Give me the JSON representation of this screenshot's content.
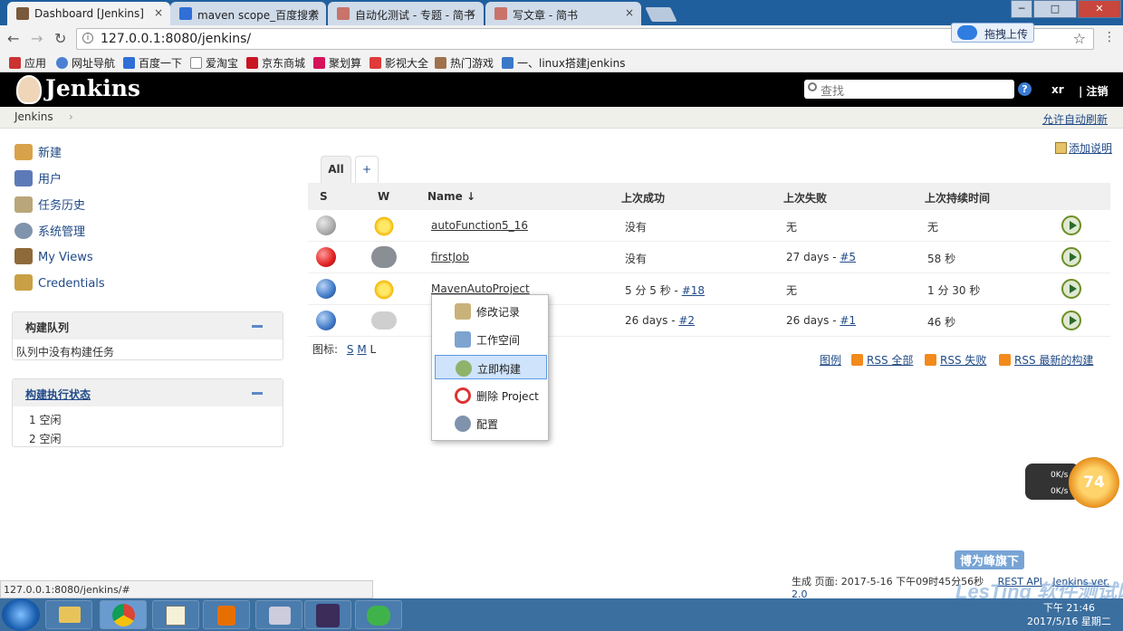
{
  "browser": {
    "tabs": [
      {
        "title": "Dashboard [Jenkins]",
        "fav_color": "#7a5a3c",
        "close": "×"
      },
      {
        "title": "maven scope_百度搜索",
        "fav_color": "#2f6fd6",
        "close": "×"
      },
      {
        "title": "自动化测试 - 专题 - 简书",
        "fav_color": "#c9736a",
        "close": "×"
      },
      {
        "title": "写文章 - 简书",
        "fav_color": "#c9736a",
        "close": "×"
      }
    ],
    "window_controls": [
      "─",
      "□",
      "✕"
    ],
    "url": "127.0.0.1:8080/jenkins/",
    "upload_button": "拖拽上传",
    "bookmarks": [
      {
        "label": "应用",
        "color": "#cc3333"
      },
      {
        "label": "网址导航",
        "color": "#4a7fd4"
      },
      {
        "label": "百度一下",
        "color": "#2f6fd6"
      },
      {
        "label": "爱淘宝",
        "color": "#dddddd"
      },
      {
        "label": "京东商城",
        "color": "#c91623"
      },
      {
        "label": "聚划算",
        "color": "#d4145a"
      },
      {
        "label": "影视大全",
        "color": "#e03a3a"
      },
      {
        "label": "热门游戏",
        "color": "#a0724c"
      },
      {
        "label": "一、linux搭建jenkins",
        "color": "#3c78c8"
      }
    ]
  },
  "jenkins": {
    "logo_text": "Jenkins",
    "search_placeholder": "查找",
    "help": "?",
    "user": "xr",
    "logout": "| 注销",
    "breadcrumb": "Jenkins",
    "breadcrumb_arrow": "›",
    "auto_refresh": "允许自动刷新",
    "add_description": "添加说明",
    "sidebar": [
      {
        "label": "新建",
        "color": "#d8a24a"
      },
      {
        "label": "用户",
        "color": "#5d7ab8"
      },
      {
        "label": "任务历史",
        "color": "#b9a77a"
      },
      {
        "label": "系统管理",
        "color": "#7f93ad"
      },
      {
        "label": "My Views",
        "color": "#8e6a3a"
      },
      {
        "label": "Credentials",
        "color": "#c9a043"
      }
    ],
    "queue": {
      "title": "构建队列",
      "empty": "队列中没有构建任务"
    },
    "executors": {
      "title": "构建执行状态",
      "items": [
        "1  空闲",
        "2  空闲"
      ]
    },
    "view_tabs": {
      "all": "All",
      "add": "+"
    },
    "table": {
      "headers": {
        "s": "S",
        "w": "W",
        "name": "Name  ↓",
        "last_success": "上次成功",
        "last_failure": "上次失败",
        "last_duration": "上次持续时间"
      },
      "rows": [
        {
          "name": "autoFunction5_16",
          "status_color": "#a9a9a9",
          "weather": "sun",
          "last_success": "没有",
          "last_success_link": "",
          "last_failure": "无",
          "last_failure_link": "",
          "duration": "无"
        },
        {
          "name": "firstJob",
          "status_color": "#e02020",
          "weather": "storm",
          "last_success": "没有",
          "last_success_link": "",
          "last_failure": "27 days - ",
          "last_failure_link": "#5",
          "duration": "58 秒"
        },
        {
          "name": "MavenAutoProject",
          "status_color": "#3f79c7",
          "weather": "sun",
          "last_success": "5 分 5 秒 - ",
          "last_success_link": "#18",
          "last_failure": "无",
          "last_failure_link": "",
          "duration": "1 分 30 秒"
        },
        {
          "name": "",
          "status_color": "#3f79c7",
          "weather": "cloud",
          "last_success": "26 days - ",
          "last_success_link": "#2",
          "last_failure": "26 days - ",
          "last_failure_link": "#1",
          "duration": "46 秒"
        }
      ]
    },
    "icon_size": {
      "label": "图标:",
      "s": "S",
      "m": "M",
      "l": "L"
    },
    "legend": "图例",
    "rss_all": "RSS 全部",
    "rss_failed": "RSS 失败",
    "rss_latest": "RSS 最新的构建",
    "context_menu": [
      {
        "label": "修改记录",
        "color": "#c9b27a"
      },
      {
        "label": "工作空间",
        "color": "#7ea3cf"
      },
      {
        "label": "立即构建",
        "color": "#8fb36a"
      },
      {
        "label": "删除 Project",
        "color": "#d33"
      },
      {
        "label": "配置",
        "color": "#7f93ad"
      }
    ],
    "footer": {
      "generated": "生成 页面: 2017-5-16 下午09时45分56秒",
      "rest": "REST API",
      "version": "Jenkins ver. 2.0"
    }
  },
  "status_url": "127.0.0.1:8080/jenkins/#",
  "net_meter": {
    "up": "0K/s",
    "down": "0K/s",
    "badge": "74"
  },
  "watermark": {
    "line1": "博为峰旗下",
    "line2": "LesTing 软件测试网"
  },
  "taskbar": {
    "time": "下午 21:46",
    "date": "2017/5/16 星期二"
  }
}
